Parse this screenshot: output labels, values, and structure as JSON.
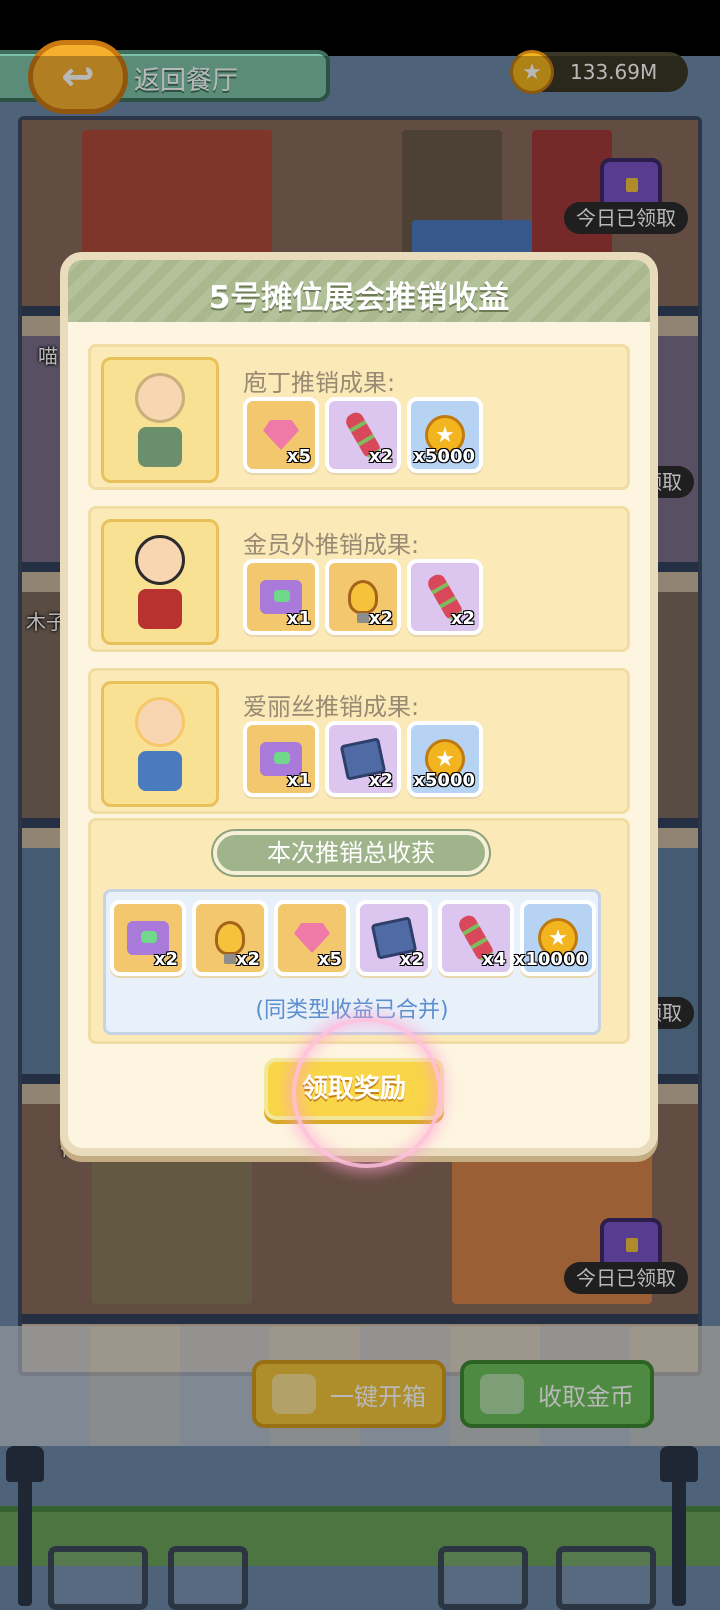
{
  "topbar": {
    "back_label": "返回餐厅",
    "coins": "133.69M"
  },
  "scene": {
    "claimed_tags": [
      "今日已领取",
      "领取",
      "领取",
      "今日已领取"
    ],
    "side_labels": [
      "喵",
      "木子",
      "得"
    ]
  },
  "dialog": {
    "title": "5号摊位展会推销收益",
    "characters": [
      {
        "title": "庖丁推销成果:",
        "items": [
          {
            "icon": "pink-gem-icon",
            "qty": "x5",
            "bg": "gold"
          },
          {
            "icon": "skewer-icon",
            "qty": "x2",
            "bg": "purple"
          },
          {
            "icon": "coin-icon",
            "qty": "x5000",
            "bg": "blue"
          }
        ]
      },
      {
        "title": "金员外推销成果:",
        "items": [
          {
            "icon": "puzzle-piece-icon",
            "qty": "x1",
            "bg": "gold"
          },
          {
            "icon": "light-bulb-icon",
            "qty": "x2",
            "bg": "gold"
          },
          {
            "icon": "skewer-icon",
            "qty": "x2",
            "bg": "purple"
          }
        ]
      },
      {
        "title": "爱丽丝推销成果:",
        "items": [
          {
            "icon": "puzzle-piece-icon",
            "qty": "x1",
            "bg": "gold"
          },
          {
            "icon": "blue-book-icon",
            "qty": "x2",
            "bg": "purple"
          },
          {
            "icon": "coin-icon",
            "qty": "x5000",
            "bg": "blue"
          }
        ]
      }
    ],
    "total_title": "本次推销总收获",
    "total_items": [
      {
        "icon": "puzzle-piece-icon",
        "qty": "x2",
        "bg": "gold"
      },
      {
        "icon": "light-bulb-icon",
        "qty": "x2",
        "bg": "gold"
      },
      {
        "icon": "pink-gem-icon",
        "qty": "x5",
        "bg": "gold"
      },
      {
        "icon": "blue-book-icon",
        "qty": "x2",
        "bg": "purple"
      },
      {
        "icon": "skewer-icon",
        "qty": "x4",
        "bg": "purple"
      },
      {
        "icon": "coin-icon",
        "qty": "x10000",
        "bg": "blue"
      }
    ],
    "merged_note": "(同类型收益已合并)",
    "claim_label": "领取奖励"
  },
  "bottom": {
    "open_all_label": "一键开箱",
    "collect_coins_label": "收取金币"
  },
  "colors": {
    "header_green": "#aab98d",
    "claim_yellow": "#f9d548",
    "panel_cream": "#fdf5e0"
  }
}
